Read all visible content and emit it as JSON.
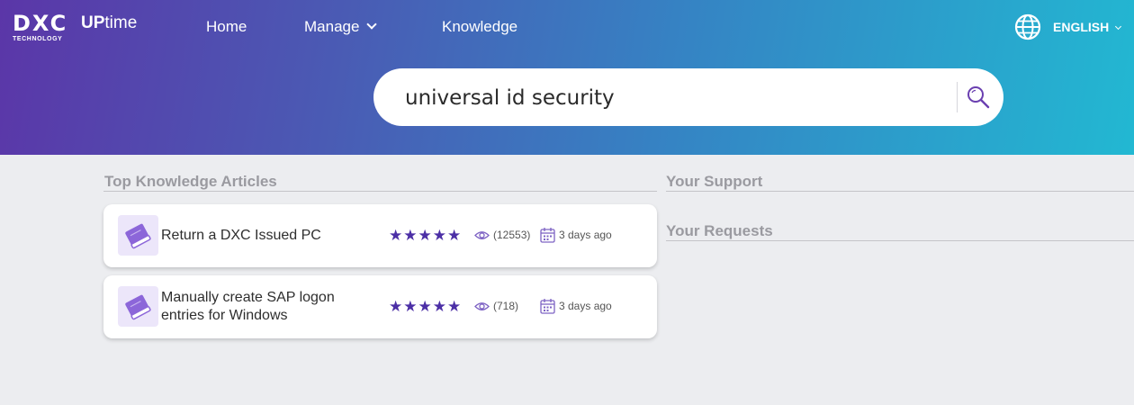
{
  "brand": {
    "logo_text": "DXC",
    "logo_sub": "TECHNOLOGY",
    "product_prefix": "UP",
    "product_suffix": "time"
  },
  "nav": {
    "home": "Home",
    "manage": "Manage",
    "knowledge": "Knowledge",
    "language": "ENGLISH"
  },
  "search": {
    "value": "universal id security"
  },
  "sections": {
    "top_articles": "Top Knowledge Articles",
    "your_support": "Your Support",
    "your_requests": "Your Requests"
  },
  "articles": [
    {
      "title": "Return a DXC Issued PC",
      "stars": "★★★★★",
      "rating": 5,
      "views": "(12553)",
      "age": "3 days ago"
    },
    {
      "title": "Manually create SAP logon entries for Windows",
      "stars": "★★★★★",
      "rating": 5,
      "views": "(718)",
      "age": "3 days ago"
    }
  ],
  "colors": {
    "gradient_start": "#5b36a8",
    "gradient_end": "#22b8d2",
    "accent": "#4c2fa6",
    "icon_bg": "#ece6fa"
  },
  "icons": [
    "globe-icon",
    "search-icon",
    "book-icon",
    "eye-icon",
    "calendar-icon",
    "chevron-down-icon"
  ]
}
